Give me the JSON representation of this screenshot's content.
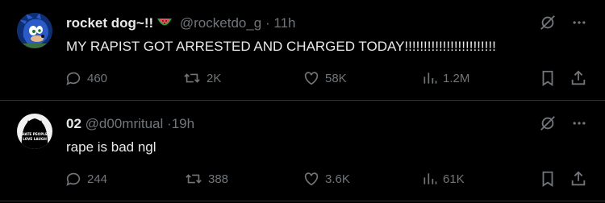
{
  "posts": [
    {
      "display_name": "rocket dog~!!",
      "name_emoji": "watermelon-emoji",
      "handle": "@rocketdo_g",
      "separator": "·",
      "time": "11h",
      "text": "MY RAPIST GOT ARRESTED AND CHARGED TODAY!!!!!!!!!!!!!!!!!!!!!!!!",
      "replies": "460",
      "reposts": "2K",
      "likes": "58K",
      "views": "1.2M"
    },
    {
      "display_name": "02",
      "handle": "@d00mritual",
      "separator": "·",
      "time": "19h",
      "text": "rape is bad ngl",
      "avatar_text": [
        "HATE PEOPLE",
        "LOVE LAUGH"
      ],
      "replies": "244",
      "reposts": "388",
      "likes": "3.6K",
      "views": "61K"
    }
  ],
  "icons": {
    "grok": "grok-icon",
    "more": "more-icon",
    "reply": "reply-icon",
    "repost": "repost-icon",
    "like": "like-icon",
    "views": "views-icon",
    "bookmark": "bookmark-icon",
    "share": "share-icon"
  },
  "colors": {
    "background": "#000000",
    "text": "#e7e9ea",
    "muted": "#71767b",
    "divider": "#2f3336"
  }
}
